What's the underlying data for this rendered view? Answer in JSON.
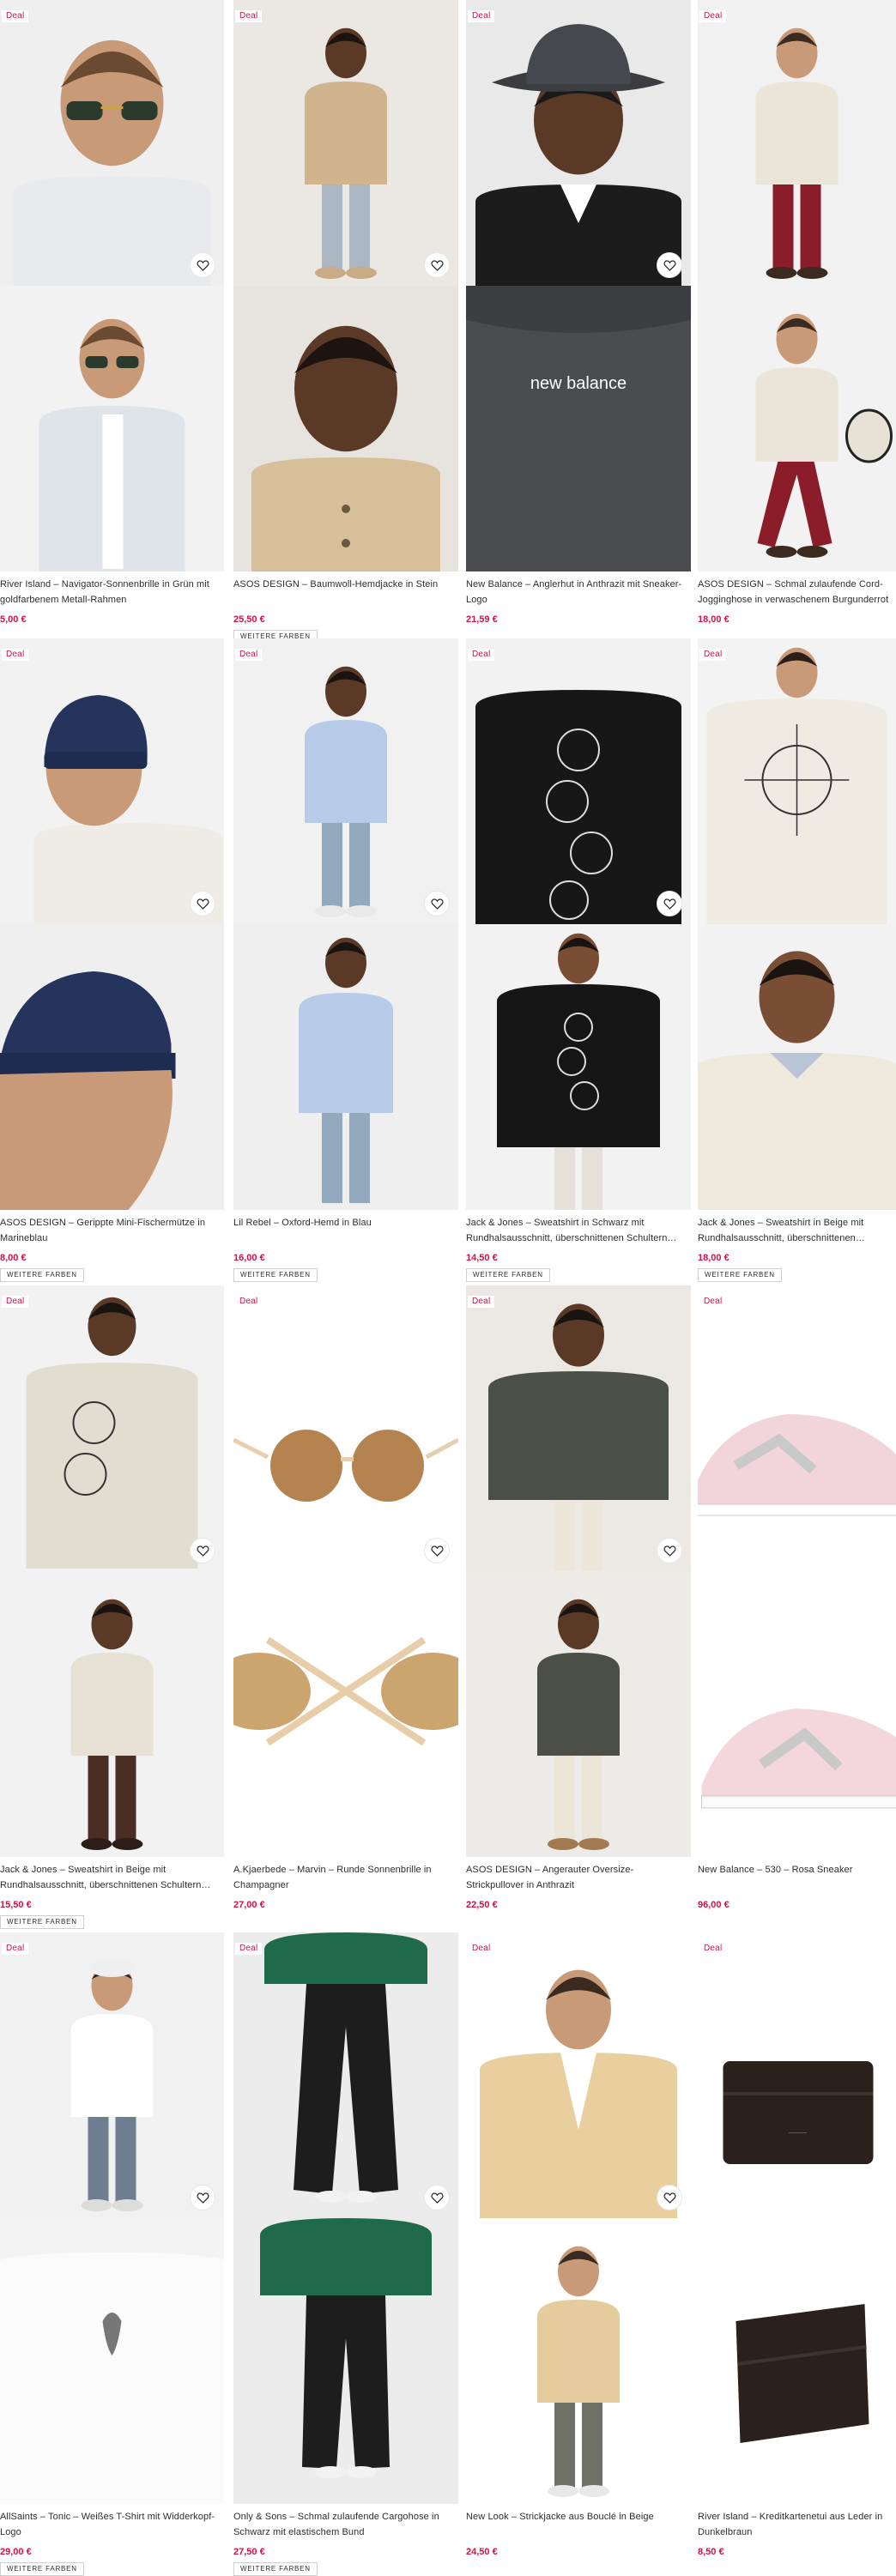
{
  "deal_label": "Deal",
  "more_colors_label": "WEITERE FARBEN",
  "products": [
    {
      "name": "River Island – Navigator-Sonnenbrille in Grün mit goldfarbenem Metall-Rahmen",
      "price": "5,00 €",
      "more_colors": false,
      "images": [
        "model-sunglasses",
        "model-sunglasses-jacket"
      ]
    },
    {
      "name": "ASOS DESIGN – Baumwoll-Hemdjacke in Stein",
      "price": "25,50 €",
      "more_colors": true,
      "images": [
        "model-beige-shirt-jacket-full",
        "model-beige-shirt-jacket-close"
      ]
    },
    {
      "name": "New Balance – Anglerhut in Anthrazit mit Sneaker-Logo",
      "price": "21,59 €",
      "more_colors": false,
      "images": [
        "model-bucket-hat",
        "bucket-hat-product"
      ]
    },
    {
      "name": "ASOS DESIGN – Schmal zulaufende Cord-Jogginghose in verwaschenem Burgunderrot",
      "price": "18,00 €",
      "more_colors": false,
      "images": [
        "model-burgundy-joggers",
        "model-burgundy-joggers-walking"
      ]
    },
    {
      "name": "ASOS DESIGN – Gerippte Mini-Fischermütze in Marineblau",
      "price": "8,00 €",
      "more_colors": true,
      "images": [
        "model-navy-beanie",
        "model-navy-beanie-side"
      ]
    },
    {
      "name": "Lil Rebel – Oxford-Hemd in Blau",
      "price": "16,00 €",
      "more_colors": true,
      "images": [
        "model-blue-oxford-shirt",
        "model-blue-oxford-shirt-back"
      ]
    },
    {
      "name": "Jack & Jones – Sweatshirt in Schwarz mit Rundhalsausschnitt, überschnittenen Schultern und...",
      "price": "14,50 €",
      "more_colors": true,
      "images": [
        "black-sweatshirt-skull-print",
        "model-black-sweatshirt"
      ]
    },
    {
      "name": "Jack & Jones – Sweatshirt in Beige mit Rundhalsausschnitt, überschnittenen Schultern",
      "price": "18,00 €",
      "more_colors": true,
      "images": [
        "beige-sweatshirt-back-print",
        "model-beige-sweatshirt"
      ]
    },
    {
      "name": "Jack & Jones – Sweatshirt in Beige mit Rundhalsausschnitt, überschnittenen Schultern und...",
      "price": "15,50 €",
      "more_colors": true,
      "images": [
        "model-beige-skull-sweatshirt-back",
        "model-beige-skull-sweatshirt-front"
      ]
    },
    {
      "name": "A.Kjaerbede – Marvin – Runde Sonnenbrille in Champagner",
      "price": "27,00 €",
      "more_colors": false,
      "images": [
        "round-sunglasses-champagne",
        "round-sunglasses-folded"
      ]
    },
    {
      "name": "ASOS DESIGN – Angerauter Oversize-Strickpullover in Anthrazit",
      "price": "22,50 €",
      "more_colors": false,
      "images": [
        "model-charcoal-knit-jumper",
        "model-charcoal-knit-jumper-full"
      ]
    },
    {
      "name": "New Balance – 530 – Rosa Sneaker",
      "price": "96,00 €",
      "more_colors": false,
      "images": [
        "pink-sneaker-side",
        "pink-sneaker-other-side"
      ]
    },
    {
      "name": "AllSaints – Tonic – Weißes T-Shirt mit Widderkopf-Logo",
      "price": "29,00 €",
      "more_colors": true,
      "images": [
        "model-white-tshirt",
        "white-tshirt-logo-close"
      ]
    },
    {
      "name": "Only & Sons – Schmal zulaufende Cargohose in Schwarz mit elastischem Bund",
      "price": "27,50 €",
      "more_colors": true,
      "images": [
        "model-black-cargo-pants",
        "model-black-cargo-pants-full"
      ]
    },
    {
      "name": "New Look – Strickjacke aus Bouclé in Beige",
      "price": "24,50 €",
      "more_colors": false,
      "images": [
        "model-beige-boucle-cardigan",
        "model-beige-boucle-cardigan-full"
      ]
    },
    {
      "name": "River Island – Kreditkartenetui aus Leder in Dunkelbraun",
      "price": "8,50 €",
      "more_colors": false,
      "images": [
        "leather-cardholder-front",
        "leather-cardholder-back"
      ]
    }
  ]
}
